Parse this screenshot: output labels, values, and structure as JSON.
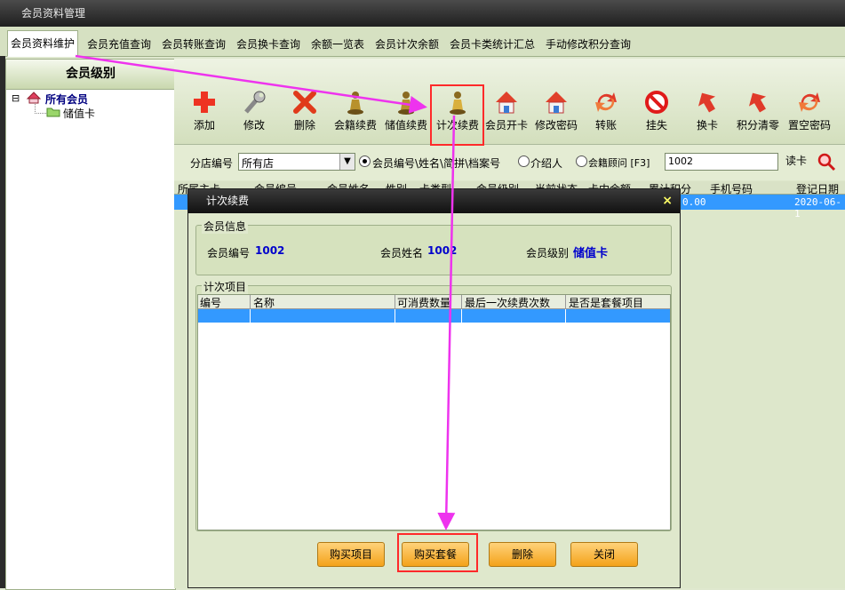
{
  "window": {
    "title": "会员资料管理"
  },
  "tabs": [
    {
      "label": "会员资料维护",
      "active": true
    },
    {
      "label": "会员充值查询"
    },
    {
      "label": "会员转账查询"
    },
    {
      "label": "会员换卡查询"
    },
    {
      "label": "余额一览表"
    },
    {
      "label": "会员计次余额"
    },
    {
      "label": "会员卡类统计汇总"
    },
    {
      "label": "手动修改积分查询"
    }
  ],
  "left_panel": {
    "header": "会员级别",
    "tree_root": "所有会员",
    "tree_child": "储值卡",
    "expander": "⊟"
  },
  "toolbar": {
    "buttons": [
      {
        "label": "添加",
        "icon": "add-icon"
      },
      {
        "label": "修改",
        "icon": "wrench-icon"
      },
      {
        "label": "删除",
        "icon": "delete-icon"
      },
      {
        "label": "会籍续费",
        "icon": "pawn-icon"
      },
      {
        "label": "储值续费",
        "icon": "pawn-icon"
      },
      {
        "label": "计次续费",
        "icon": "pawn-icon"
      },
      {
        "label": "会员开卡",
        "icon": "house-icon"
      },
      {
        "label": "修改密码",
        "icon": "house-icon"
      },
      {
        "label": "转账",
        "icon": "transfer-icon"
      },
      {
        "label": "挂失",
        "icon": "block-icon"
      },
      {
        "label": "换卡",
        "icon": "card-swap-icon"
      },
      {
        "label": "积分清零",
        "icon": "card-swap-icon"
      },
      {
        "label": "置空密码",
        "icon": "transfer-icon"
      }
    ]
  },
  "filter": {
    "store_label": "分店编号",
    "store_value": "所有店",
    "radio1": "会员编号\\姓名\\简拼\\档案号",
    "radio2": "介绍人",
    "radio3": "会籍顾问 [F3]",
    "search_value": "1002",
    "read_card": "读卡"
  },
  "grid": {
    "headers": [
      "所属主卡",
      "会员编号",
      "会员姓名",
      "性别",
      "卡类型",
      "会员级别",
      "当前状态",
      "卡内余额",
      "累计积分",
      "手机号码",
      "登记日期"
    ],
    "row": {
      "points": "0.00",
      "date": "2020-06-1"
    }
  },
  "dialog": {
    "title": "计次续费",
    "close": "×",
    "member_info_title": "会员信息",
    "member_no_label": "会员编号",
    "member_no": "1002",
    "member_name_label": "会员姓名",
    "member_name": "1002",
    "member_level_label": "会员级别",
    "member_level": "储值卡",
    "items_title": "计次项目",
    "item_columns": [
      "编号",
      "名称",
      "可消费数量",
      "最后一次续费次数",
      "是否是套餐项目"
    ],
    "buttons": [
      "购买项目",
      "购买套餐",
      "删除",
      "关闭"
    ]
  },
  "colors": {
    "selection": "#3399ff",
    "arrow": "#ee33ee",
    "highlight_box": "#ff2a2a",
    "button_orange": "#f4a21a"
  }
}
